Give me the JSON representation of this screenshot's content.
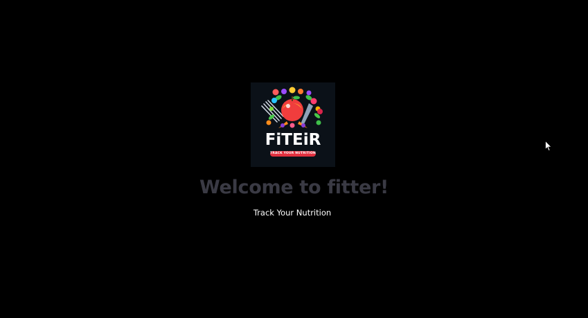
{
  "logo": {
    "wordmark": "FiTEiR",
    "tagline": "TRACK YOUR NUTRITION",
    "icon": "fruit-basket-logo"
  },
  "welcome": {
    "title": "Welcome to fitter!",
    "subtitle": "Track Your Nutrition"
  },
  "cursor": {
    "icon": "mouse-pointer-icon"
  },
  "colors": {
    "background": "#000000",
    "title": "#3a3a44",
    "subtitle": "#ffffff",
    "logo_background": "#0b1118",
    "tagline_badge": "#e2303f"
  }
}
